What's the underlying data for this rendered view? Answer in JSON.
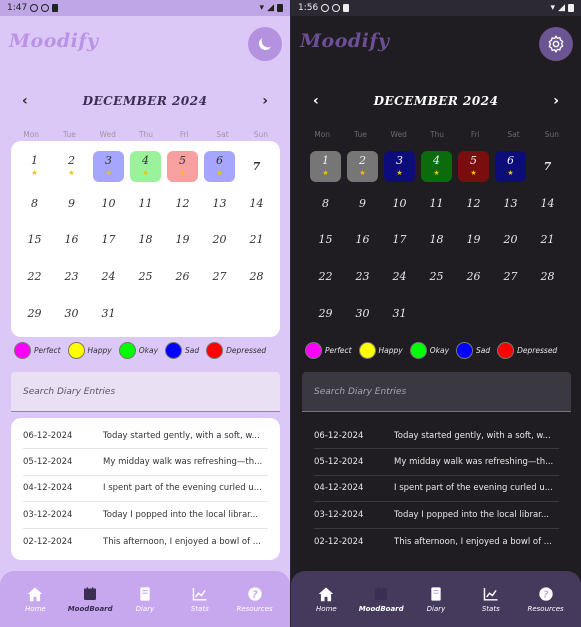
{
  "status": {
    "light_time": "1:47",
    "dark_time": "1:56"
  },
  "app": {
    "title": "Moodify"
  },
  "calendar": {
    "month_label": "DECEMBER 2024",
    "weekdays": [
      "Mon",
      "Tue",
      "Wed",
      "Thu",
      "Fri",
      "Sat",
      "Sun"
    ]
  },
  "legend": [
    {
      "label": "Perfect",
      "color": "#ff00ff"
    },
    {
      "label": "Happy",
      "color": "#ffff00"
    },
    {
      "label": "Okay",
      "color": "#00ff00"
    },
    {
      "label": "Sad",
      "color": "#0000ff"
    },
    {
      "label": "Depressed",
      "color": "#ff0000"
    }
  ],
  "mood_days_light": {
    "3": "#a6a6ff",
    "4": "#9af29a",
    "5": "#f7a0a0",
    "6": "#a6a6ff"
  },
  "mood_days_dark": {
    "1": "#767676",
    "2": "#767676",
    "3": "#0c0c7a",
    "4": "#0c6b0c",
    "5": "#7a0d0d",
    "6": "#0c0c7a"
  },
  "starred_days": [
    1,
    2,
    3,
    4,
    5,
    6
  ],
  "today": 7,
  "search": {
    "placeholder": "Search Diary Entries"
  },
  "diary": [
    {
      "date": "06-12-2024",
      "text": "Today started gently, with a soft, w..."
    },
    {
      "date": "05-12-2024",
      "text": "My midday walk was refreshing—th..."
    },
    {
      "date": "04-12-2024",
      "text": "I spent part of the evening curled u..."
    },
    {
      "date": "03-12-2024",
      "text": "Today I popped into the local librar..."
    },
    {
      "date": "02-12-2024",
      "text": "This afternoon, I enjoyed a bowl of ..."
    }
  ],
  "nav": [
    {
      "label": "Home",
      "icon": "home-icon"
    },
    {
      "label": "MoodBoard",
      "icon": "calendar-icon"
    },
    {
      "label": "Diary",
      "icon": "book-icon"
    },
    {
      "label": "Stats",
      "icon": "chart-icon"
    },
    {
      "label": "Resources",
      "icon": "help-icon"
    }
  ]
}
